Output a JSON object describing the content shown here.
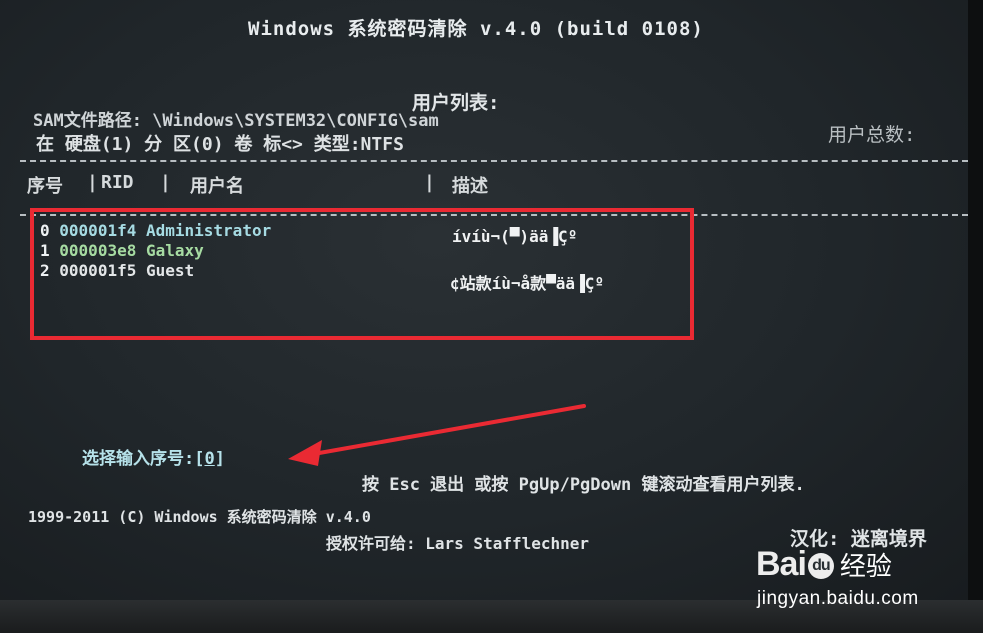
{
  "title": "Windows 系统密码清除 v.4.0 (build 0108)",
  "heading": "用户列表:",
  "sam_path": "SAM文件路径: \\Windows\\SYSTEM32\\CONFIG\\sam",
  "disk_info": "在 硬盘(1)  分 区(0) 卷 标<> 类型:NTFS",
  "total_users_label": "用户总数:",
  "columns": {
    "index": "序号",
    "sep1": "|",
    "rid": "RID",
    "sep2": "|",
    "username": "用户名",
    "sep3": "|",
    "description": "描述"
  },
  "users": [
    {
      "index": "0",
      "rid": "000001f4",
      "name": "Administrator",
      "description": "ívíù¬(▀)ää▐Çº"
    },
    {
      "index": "1",
      "rid": "000003e8",
      "name": "Galaxy",
      "description": ""
    },
    {
      "index": "2",
      "rid": "000001f5",
      "name": "Guest",
      "description": "¢站款íù¬å款▀ää▐Çº"
    }
  ],
  "prompt": {
    "label": "选择输入序号:[",
    "value": "0",
    "close": "]"
  },
  "hint": "按 Esc 退出   或按 PgUp/PgDown 键滚动查看用户列表.",
  "copyright": "1999-2011 (C)  Windows 系统密码清除 v.4.0",
  "licensed": "授权许可给:  Lars Stafflechner",
  "localized_by": "汉化: 迷离境界",
  "annotation_color": "#ea2a33",
  "watermark": {
    "brand_left": "Bai",
    "brand_paw": "du",
    "brand_cn": "经验",
    "url": "jingyan.baidu.com"
  }
}
